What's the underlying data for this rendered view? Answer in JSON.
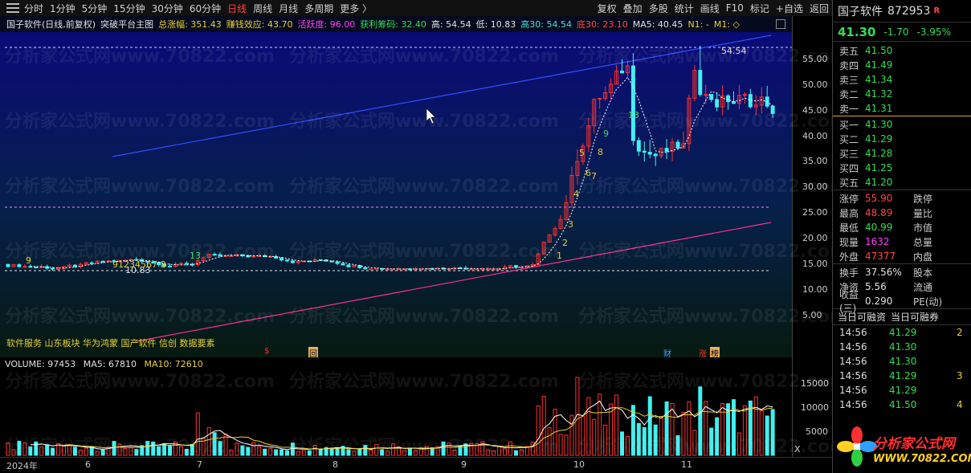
{
  "toolbar": {
    "periods": [
      "分时",
      "1分钟",
      "5分钟",
      "15分钟",
      "30分钟",
      "60分钟",
      "日线",
      "周线",
      "月线",
      "多周期",
      "更多 〉"
    ],
    "active_period": "日线",
    "right_items": [
      "复权",
      "叠加",
      "多股",
      "统计",
      "画线",
      "F10",
      "标记",
      "+自选",
      "返回"
    ]
  },
  "chart_title": {
    "stock": "国子软件(日线,前复权)",
    "formula": "突破平台主图",
    "total_gain": "总涨幅: 351.43",
    "money_effect": "赚钱效应: 43.70",
    "activity": "活跃度: 96.00",
    "profit_chips": "获利筹码: 32.40",
    "high": "高: 54.54",
    "low": "低: 10.83",
    "high30": "高30: 54.54",
    "low30": "底30: 23.10",
    "ma5": "MA5: 40.45",
    "n1": "N1: -",
    "m1": "M1: ◇"
  },
  "price_axis": [
    "55.00",
    "50.00",
    "45.00",
    "40.00",
    "35.00",
    "30.00",
    "25.00",
    "20.00",
    "15.00",
    "10.00",
    "5.00"
  ],
  "annotations": {
    "high_label": "54.54",
    "low_label": "10.83",
    "seq_counts": [
      "1",
      "2",
      "3",
      "4",
      "5",
      "6",
      "7",
      "8",
      "9",
      "13"
    ],
    "left_nums": "9",
    "left_seq": "91234567 8",
    "left_13": "13"
  },
  "tags": {
    "concepts": "软件服务 山东板块 华为鸿蒙 国产软件 信创 数据要素",
    "markers": [
      "$",
      "回",
      "财",
      "涨",
      "榜"
    ]
  },
  "volume": {
    "title": "VOLUME: 97453",
    "ma5": "MA5: 67810",
    "ma10": "MA10: 72610",
    "axis": [
      "15000",
      "10000",
      "5000"
    ],
    "unit": "X"
  },
  "x_axis": [
    "2024年",
    "6",
    "7",
    "8",
    "9",
    "10",
    "11"
  ],
  "watermark": "分析家公式网www.70822.com",
  "side": {
    "name": "国子软件",
    "code": "872953",
    "r_tag": "R",
    "price": "41.30",
    "change": "-1.70",
    "pct": "-3.95%",
    "asks": [
      {
        "label": "卖五",
        "price": "41.50"
      },
      {
        "label": "卖四",
        "price": "41.49"
      },
      {
        "label": "卖三",
        "price": "41.34"
      },
      {
        "label": "卖二",
        "price": "41.32"
      },
      {
        "label": "卖一",
        "price": "41.31"
      }
    ],
    "bids": [
      {
        "label": "买一",
        "price": "41.30"
      },
      {
        "label": "买二",
        "price": "41.29"
      },
      {
        "label": "买三",
        "price": "41.28"
      },
      {
        "label": "买四",
        "price": "41.25"
      },
      {
        "label": "买五",
        "price": "41.20"
      }
    ],
    "stats": [
      {
        "l1": "涨停",
        "v1": "55.90",
        "c1": "red",
        "l2": "跌停"
      },
      {
        "l1": "最高",
        "v1": "48.89",
        "c1": "red",
        "l2": "量比"
      },
      {
        "l1": "最低",
        "v1": "40.99",
        "c1": "green",
        "l2": "市值"
      },
      {
        "l1": "现量",
        "v1": "1632",
        "c1": "mag",
        "l2": "总量"
      },
      {
        "l1": "外盘",
        "v1": "47377",
        "c1": "red",
        "l2": "内盘"
      }
    ],
    "stats2": [
      {
        "l1": "换手",
        "v1": "37.56%",
        "l2": "股本"
      },
      {
        "l1": "净资",
        "v1": "5.56",
        "l2": "流通"
      },
      {
        "l1": "收益(三)",
        "v1": "0.290",
        "l2": "PE(动)"
      }
    ],
    "margin_tabs": [
      "当日可融资",
      "当日可融券"
    ],
    "ticks": [
      {
        "time": "14:56",
        "price": "41.29",
        "vol": "2"
      },
      {
        "time": "14:56",
        "price": "41.30",
        "vol": ""
      },
      {
        "time": "14:56",
        "price": "41.30",
        "vol": ""
      },
      {
        "time": "14:56",
        "price": "41.29",
        "vol": "3"
      },
      {
        "time": "14:56",
        "price": "41.29",
        "vol": ""
      },
      {
        "time": "14:56",
        "price": "41.50",
        "vol": "4"
      }
    ],
    "logo_text": "分析家公式网",
    "logo_url": "WWW.70822.COM"
  },
  "colors": {
    "up": "#ff3030",
    "down": "#40f0f0",
    "upper_channel": "#3050ff",
    "lower_channel": "#ff3090"
  }
}
